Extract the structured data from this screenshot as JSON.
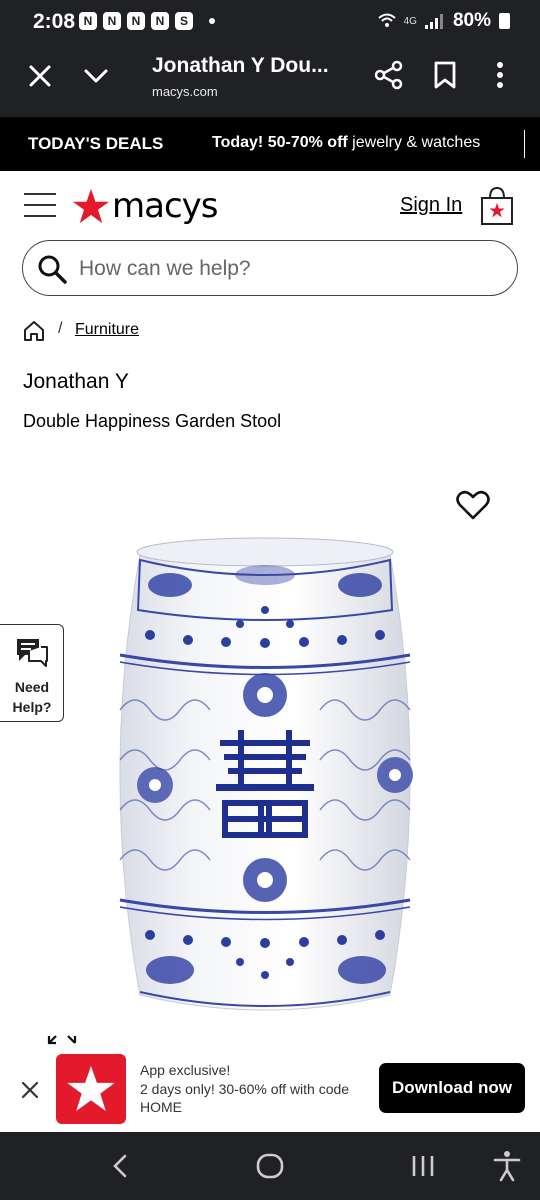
{
  "status_bar": {
    "time": "2:08",
    "notification_icons": [
      "N",
      "N",
      "N",
      "N",
      "S"
    ],
    "network": "4G",
    "battery": "80%"
  },
  "browser": {
    "title": "Jonathan Y Dou...",
    "url": "macys.com"
  },
  "deals_banner": {
    "label": "TODAY'S DEALS",
    "headline": "Today! 50-70% off",
    "detail": " jewelry & watches"
  },
  "header": {
    "logo_text": "macys",
    "sign_in": "Sign In"
  },
  "search": {
    "placeholder": "How can we help?"
  },
  "breadcrumb": {
    "separator": "/",
    "link": "Furniture"
  },
  "product": {
    "brand": "Jonathan Y",
    "name": "Double Happiness Garden Stool"
  },
  "need_help": {
    "line1": "Need",
    "line2": "Help?"
  },
  "app_banner": {
    "line1": "App exclusive!",
    "line2": "2 days only! 30-60% off with code HOME",
    "button": "Download now"
  },
  "colors": {
    "macys_red": "#e21a2c",
    "porcelain_blue": "#2b3f9e",
    "dark_bar": "#202124"
  }
}
